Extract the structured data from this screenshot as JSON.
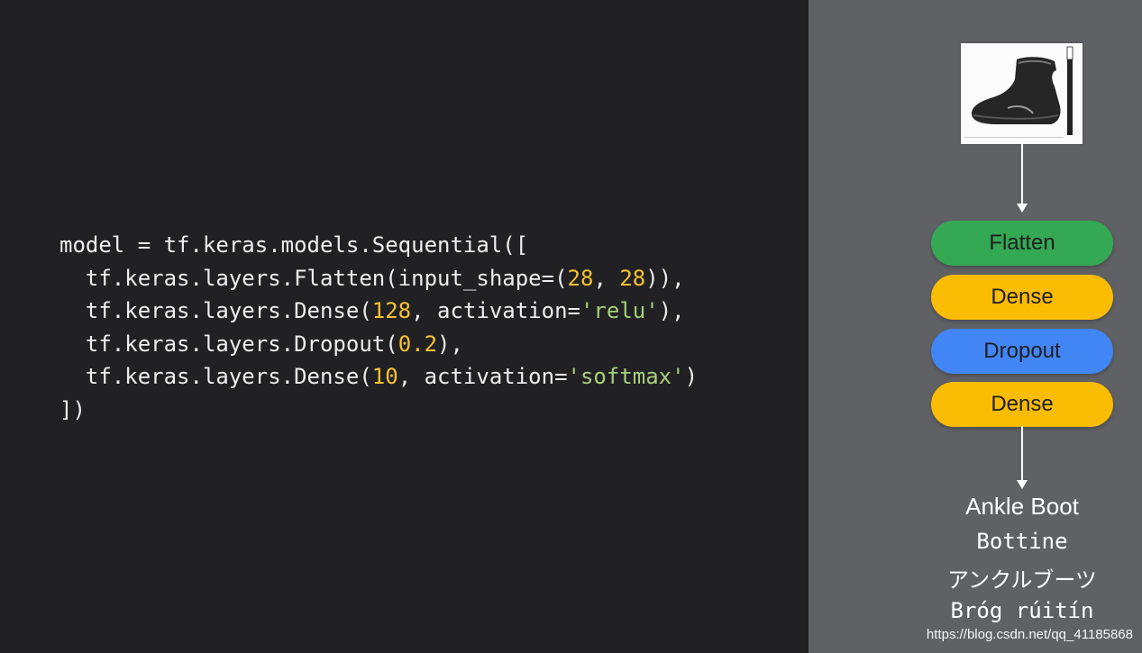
{
  "code": {
    "lines": [
      [
        {
          "t": "model = tf.keras.models.Sequential([",
          "c": "plain"
        }
      ],
      [
        {
          "t": "  tf.keras.layers.Flatten(input_shape=(",
          "c": "plain"
        },
        {
          "t": "28",
          "c": "num"
        },
        {
          "t": ", ",
          "c": "plain"
        },
        {
          "t": "28",
          "c": "num"
        },
        {
          "t": ")),",
          "c": "plain"
        }
      ],
      [
        {
          "t": "  tf.keras.layers.Dense(",
          "c": "plain"
        },
        {
          "t": "128",
          "c": "num"
        },
        {
          "t": ", activation=",
          "c": "plain"
        },
        {
          "t": "'relu'",
          "c": "str"
        },
        {
          "t": "),",
          "c": "plain"
        }
      ],
      [
        {
          "t": "  tf.keras.layers.Dropout(",
          "c": "plain"
        },
        {
          "t": "0.2",
          "c": "num"
        },
        {
          "t": "),",
          "c": "plain"
        }
      ],
      [
        {
          "t": "  tf.keras.layers.Dense(",
          "c": "plain"
        },
        {
          "t": "10",
          "c": "num"
        },
        {
          "t": ", activation=",
          "c": "plain"
        },
        {
          "t": "'softmax'",
          "c": "str"
        },
        {
          "t": ")",
          "c": "plain"
        }
      ],
      [
        {
          "t": "])",
          "c": "plain"
        }
      ]
    ]
  },
  "diagram": {
    "input_image_icon": "ankle-boot-image",
    "layers": [
      {
        "label": "Flatten",
        "color": "#34a853"
      },
      {
        "label": "Dense",
        "color": "#fbbc04"
      },
      {
        "label": "Dropout",
        "color": "#4285f4"
      },
      {
        "label": "Dense",
        "color": "#fbbc04"
      }
    ],
    "outputs": [
      "Ankle Boot",
      "Bottine",
      "アンクルブーツ",
      "Bróg rúitín"
    ]
  },
  "watermark": "https://blog.csdn.net/qq_41185868",
  "colors": {
    "code_background": "#212124",
    "diagram_background": "#606165",
    "number_token": "#f7c22f",
    "string_token": "#a8cf7c"
  }
}
